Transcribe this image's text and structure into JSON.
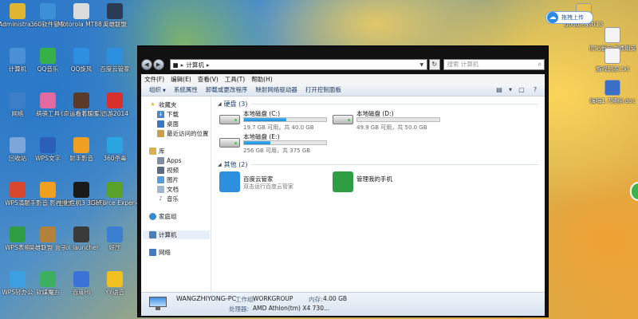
{
  "desktop": {
    "left_icons": [
      {
        "label": "Administra...",
        "icon": "user-folder-icon",
        "color": "#e0b530"
      },
      {
        "label": "360软件管家",
        "icon": "software-manager-icon",
        "color": "#3d8fd8"
      },
      {
        "label": "Motorola MT887的...",
        "icon": "phone-icon",
        "color": "#dcdcdc"
      },
      {
        "label": "英雄联盟",
        "icon": "game-icon",
        "color": "#2b3a55"
      },
      {
        "label": "计算机",
        "icon": "computer-icon",
        "color": "#4a90d6"
      },
      {
        "label": "QQ音乐",
        "icon": "music-icon",
        "color": "#38b04a"
      },
      {
        "label": "QQ旋风",
        "icon": "qq-whirlwind-icon",
        "color": "#2d8fe0"
      },
      {
        "label": "百度云管家",
        "icon": "cloud-icon",
        "color": "#2d8fe0"
      },
      {
        "label": "网络",
        "icon": "network-icon",
        "color": "#3c7fc8"
      },
      {
        "label": "萌萌工具",
        "icon": "tool-icon",
        "color": "#e26aa0"
      },
      {
        "label": "《命运看着暖暖》流...",
        "icon": "movie-icon",
        "color": "#5b3a2a"
      },
      {
        "label": "迅游2014",
        "icon": "speed-icon",
        "color": "#d8302c"
      },
      {
        "label": "回收站",
        "icon": "recycle-bin-icon",
        "color": "#7aa7d8"
      },
      {
        "label": "WPS文字",
        "icon": "wps-writer-icon",
        "color": "#2c5fb8"
      },
      {
        "label": "射手影音",
        "icon": "player-icon",
        "color": "#f0a020"
      },
      {
        "label": "360杀毒",
        "icon": "antivirus-icon",
        "color": "#2aa5e0"
      },
      {
        "label": "WPS演示",
        "icon": "wps-presentation-icon",
        "color": "#d8462c"
      },
      {
        "label": "射手影音 影视播放",
        "icon": "player-icon",
        "color": "#f0a020"
      },
      {
        "label": "生化危机3 3DM汉化",
        "icon": "game-icon",
        "color": "#1a1a1a"
      },
      {
        "label": "GeForce Experience",
        "icon": "nvidia-icon",
        "color": "#5aa12a"
      },
      {
        "label": "WPS表格",
        "icon": "wps-spreadsheet-icon",
        "color": "#2e9d43"
      },
      {
        "label": "英雄联盟 盒子",
        "icon": "box-icon",
        "color": "#b3823a"
      },
      {
        "label": "lol.launcher",
        "icon": "launcher-icon",
        "color": "#3a3a3a"
      },
      {
        "label": "好压",
        "icon": "archive-icon",
        "color": "#3a7fd0"
      },
      {
        "label": "WPS轻办公",
        "icon": "wps-office-icon",
        "color": "#3ca0e0"
      },
      {
        "label": "软媒魔方",
        "icon": "cube-icon",
        "color": "#3cb060"
      },
      {
        "label": "百度Hi",
        "icon": "chat-icon",
        "color": "#3a72d8"
      },
      {
        "label": "YY语音",
        "icon": "voice-icon",
        "color": "#f0c020"
      }
    ],
    "right_icons": [
      {
        "label": "googleasti13",
        "icon": "folder-icon",
        "color": "#e8c050"
      },
      {
        "label": "优化版安卓通用安装...",
        "icon": "document-icon",
        "color": "#f4f4f4"
      },
      {
        "label": "游戏玩家.txt",
        "icon": "text-file-icon",
        "color": "#f4f4f4"
      },
      {
        "label": "嗨嗨1.7网络.doc",
        "icon": "word-doc-icon",
        "color": "#3a6fc8"
      }
    ],
    "upload_pill": "拖拽上传"
  },
  "window": {
    "address": {
      "root": "",
      "location": "计算机"
    },
    "search_placeholder": "搜索 计算机",
    "menu": [
      "文件(F)",
      "编辑(E)",
      "查看(V)",
      "工具(T)",
      "帮助(H)"
    ],
    "toolbar": [
      "组织",
      "系统属性",
      "卸载或更改程序",
      "映射网络驱动器",
      "打开控制面板"
    ],
    "sidebar": {
      "favorites": {
        "label": "收藏夹",
        "items": [
          "下载",
          "桌面",
          "最近访问的位置"
        ]
      },
      "libraries": {
        "label": "库",
        "items": [
          "Apps",
          "视频",
          "图片",
          "文档",
          "音乐"
        ]
      },
      "homegroup": "家庭组",
      "computer": "计算机",
      "network": "网络"
    },
    "groups": {
      "drives_title": "硬盘 (3)",
      "other_title": "其他 (2)"
    },
    "drives": [
      {
        "name": "本地磁盘 (C:)",
        "free": "19.7 GB 可用，共 40.0 GB",
        "used_fraction": 0.51
      },
      {
        "name": "本地磁盘 (D:)",
        "free": "49.9 GB 可用，共 50.0 GB",
        "used_fraction": 0.0
      },
      {
        "name": "本地磁盘 (E:)",
        "free": "256 GB 可用，共 375 GB",
        "used_fraction": 0.32
      }
    ],
    "others": [
      {
        "name": "百度云管家",
        "sub": "双击运行百度云管家",
        "color": "#2d8fe0"
      },
      {
        "name": "管理我的手机",
        "sub": "",
        "color": "#2e9d43"
      }
    ],
    "details": {
      "pc_name": "WANGZHIYONG-PC",
      "workgroup_key": "工作组:",
      "workgroup_val": "WORKGROUP",
      "memory_key": "内存:",
      "memory_val": "4.00 GB",
      "cpu_key": "处理器:",
      "cpu_val": "AMD Athlon(tm) X4 730..."
    }
  }
}
